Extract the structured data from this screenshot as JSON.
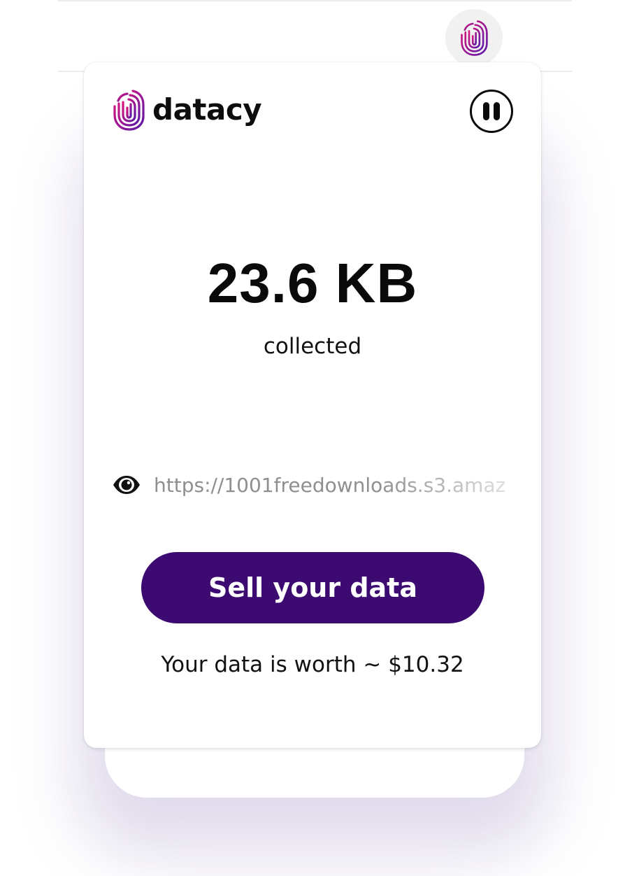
{
  "extension": {
    "icon": "fingerprint-icon"
  },
  "header": {
    "brand_name": "datacy",
    "logo_icon": "fingerprint-icon",
    "pause_icon": "pause-icon"
  },
  "stats": {
    "amount": "23.6 KB",
    "caption": "collected"
  },
  "tracking": {
    "icon": "eye-icon",
    "current_url": "https://1001freedownloads.s3.amaz"
  },
  "actions": {
    "sell_label": "Sell your data"
  },
  "footer": {
    "worth_text": "Your data is worth ~ $10.32"
  },
  "colors": {
    "primary": "#3d0a72",
    "logo_gradient_start": "#e0157a",
    "logo_gradient_end": "#5b1aa8",
    "text": "#0a0a0a",
    "muted_url": "#8f8f8f"
  }
}
